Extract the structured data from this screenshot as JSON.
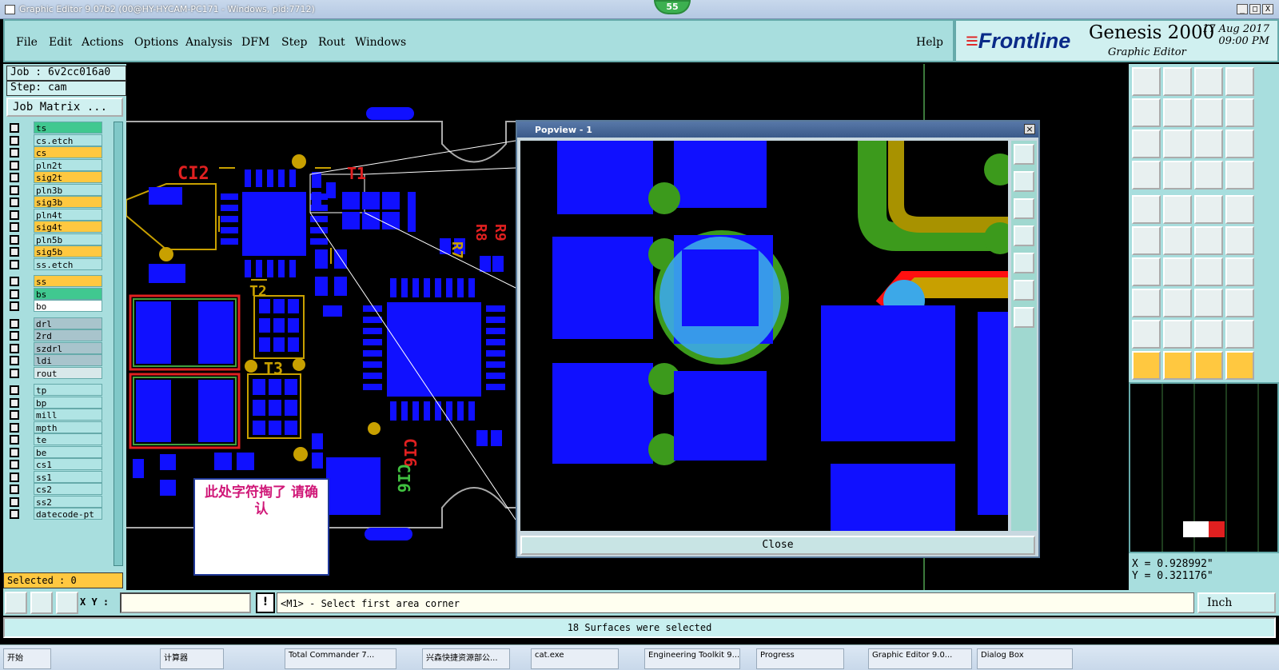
{
  "window": {
    "title": "Graphic Editor 9.07b2 (00@HY-HYCAM-PC171 - Windows, pid:7712)",
    "badge": "55",
    "controls": [
      "_",
      "□",
      "X"
    ]
  },
  "menu": {
    "items": [
      "File",
      "Edit",
      "Actions",
      "Options",
      "Analysis",
      "DFM",
      "Step",
      "Rout",
      "Windows"
    ],
    "help": "Help"
  },
  "brand": {
    "logo": "Frontline",
    "product": "Genesis 2000",
    "subtitle": "Graphic Editor",
    "date": "17 Aug 2017",
    "time": "09:00 PM"
  },
  "job": {
    "job_line": "Job : 6v2cc016a0",
    "step_line": "Step: cam",
    "matrix_button": "Job Matrix ..."
  },
  "layers": [
    {
      "name": "ts",
      "color": "#40c890"
    },
    {
      "name": "cs.etch",
      "color": "#b0e4e4"
    },
    {
      "name": "cs",
      "color": "#ffc840"
    },
    {
      "name": "pln2t",
      "color": "#b0e4e4"
    },
    {
      "name": "sig2t",
      "color": "#ffc840"
    },
    {
      "name": "pln3b",
      "color": "#b0e4e4"
    },
    {
      "name": "sig3b",
      "color": "#ffc840"
    },
    {
      "name": "pln4t",
      "color": "#b0e4e4"
    },
    {
      "name": "sig4t",
      "color": "#ffc840"
    },
    {
      "name": "pln5b",
      "color": "#b0e4e4"
    },
    {
      "name": "sig5b",
      "color": "#ffc840"
    },
    {
      "name": "ss.etch",
      "color": "#b0e4e4"
    },
    {
      "name": "ss",
      "color": "#ffc840"
    },
    {
      "name": "bs",
      "color": "#40c890"
    },
    {
      "name": "bo",
      "color": "#ffffff"
    },
    {
      "name": "drl",
      "color": "#a8c4cc"
    },
    {
      "name": "2rd",
      "color": "#a8c4cc"
    },
    {
      "name": "szdrl",
      "color": "#a8c4cc"
    },
    {
      "name": "ldi",
      "color": "#a8c4cc"
    },
    {
      "name": "rout",
      "color": "#d8e8ea"
    },
    {
      "name": "tp",
      "color": "#b0e4e4"
    },
    {
      "name": "bp",
      "color": "#b0e4e4"
    },
    {
      "name": "mill",
      "color": "#b0e4e4"
    },
    {
      "name": "mpth",
      "color": "#b0e4e4"
    },
    {
      "name": "te",
      "color": "#b0e4e4"
    },
    {
      "name": "be",
      "color": "#b0e4e4"
    },
    {
      "name": "cs1",
      "color": "#b0e4e4"
    },
    {
      "name": "ss1",
      "color": "#b0e4e4"
    },
    {
      "name": "cs2",
      "color": "#b0e4e4"
    },
    {
      "name": "ss2",
      "color": "#b0e4e4"
    },
    {
      "name": "datecode-pt",
      "color": "#b0e4e4"
    }
  ],
  "selected": "Selected : 0",
  "popview": {
    "title": "Popview - 1",
    "close_label": "Close"
  },
  "board_labels": [
    "CI2",
    "T1",
    "T2",
    "T3",
    "CI6",
    "CI6",
    "R7",
    "R8",
    "R9"
  ],
  "note": "此处字符掏了 请确认",
  "coords": {
    "x": "X = 0.928992\"",
    "y": "Y = 0.321176\""
  },
  "bottom": {
    "xy_label": "X Y :",
    "xy_value": "",
    "prompt": "<M1> - Select first area corner",
    "units": "Inch",
    "exclaim": "!"
  },
  "status": "18 Surfaces were selected",
  "taskbar": [
    "开始",
    "计算器",
    "Total Commander 7...",
    "兴森快捷资源部公...",
    "cat.exe",
    "Engineering Toolkit 9...",
    "Progress",
    "Graphic Editor 9.0...",
    "Dialog Box"
  ]
}
